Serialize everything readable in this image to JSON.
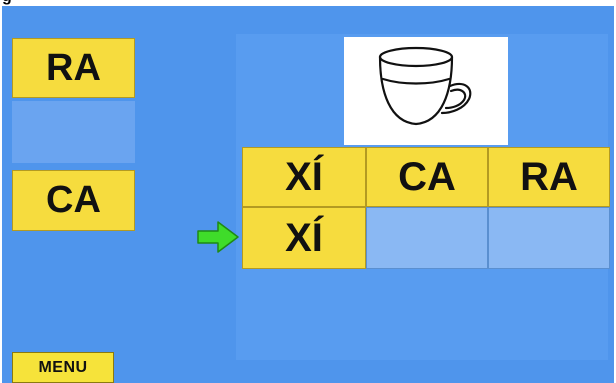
{
  "title_fragment": "g",
  "side_tiles": [
    {
      "label": "RA"
    },
    {
      "label": "CA"
    }
  ],
  "picture": {
    "icon": "cup-icon"
  },
  "answer_row": [
    "XÍ",
    "CA",
    "RA"
  ],
  "input_row": [
    "XÍ",
    "",
    ""
  ],
  "pointer": {
    "icon": "green-arrow-right-icon",
    "color": "#3fdc2a"
  },
  "menu": {
    "label": "MENU"
  },
  "colors": {
    "background": "#4f95ec",
    "tile": "#f6dc3e",
    "empty_slot": "#8ab8f3",
    "arrow": "#3fdc2a"
  }
}
